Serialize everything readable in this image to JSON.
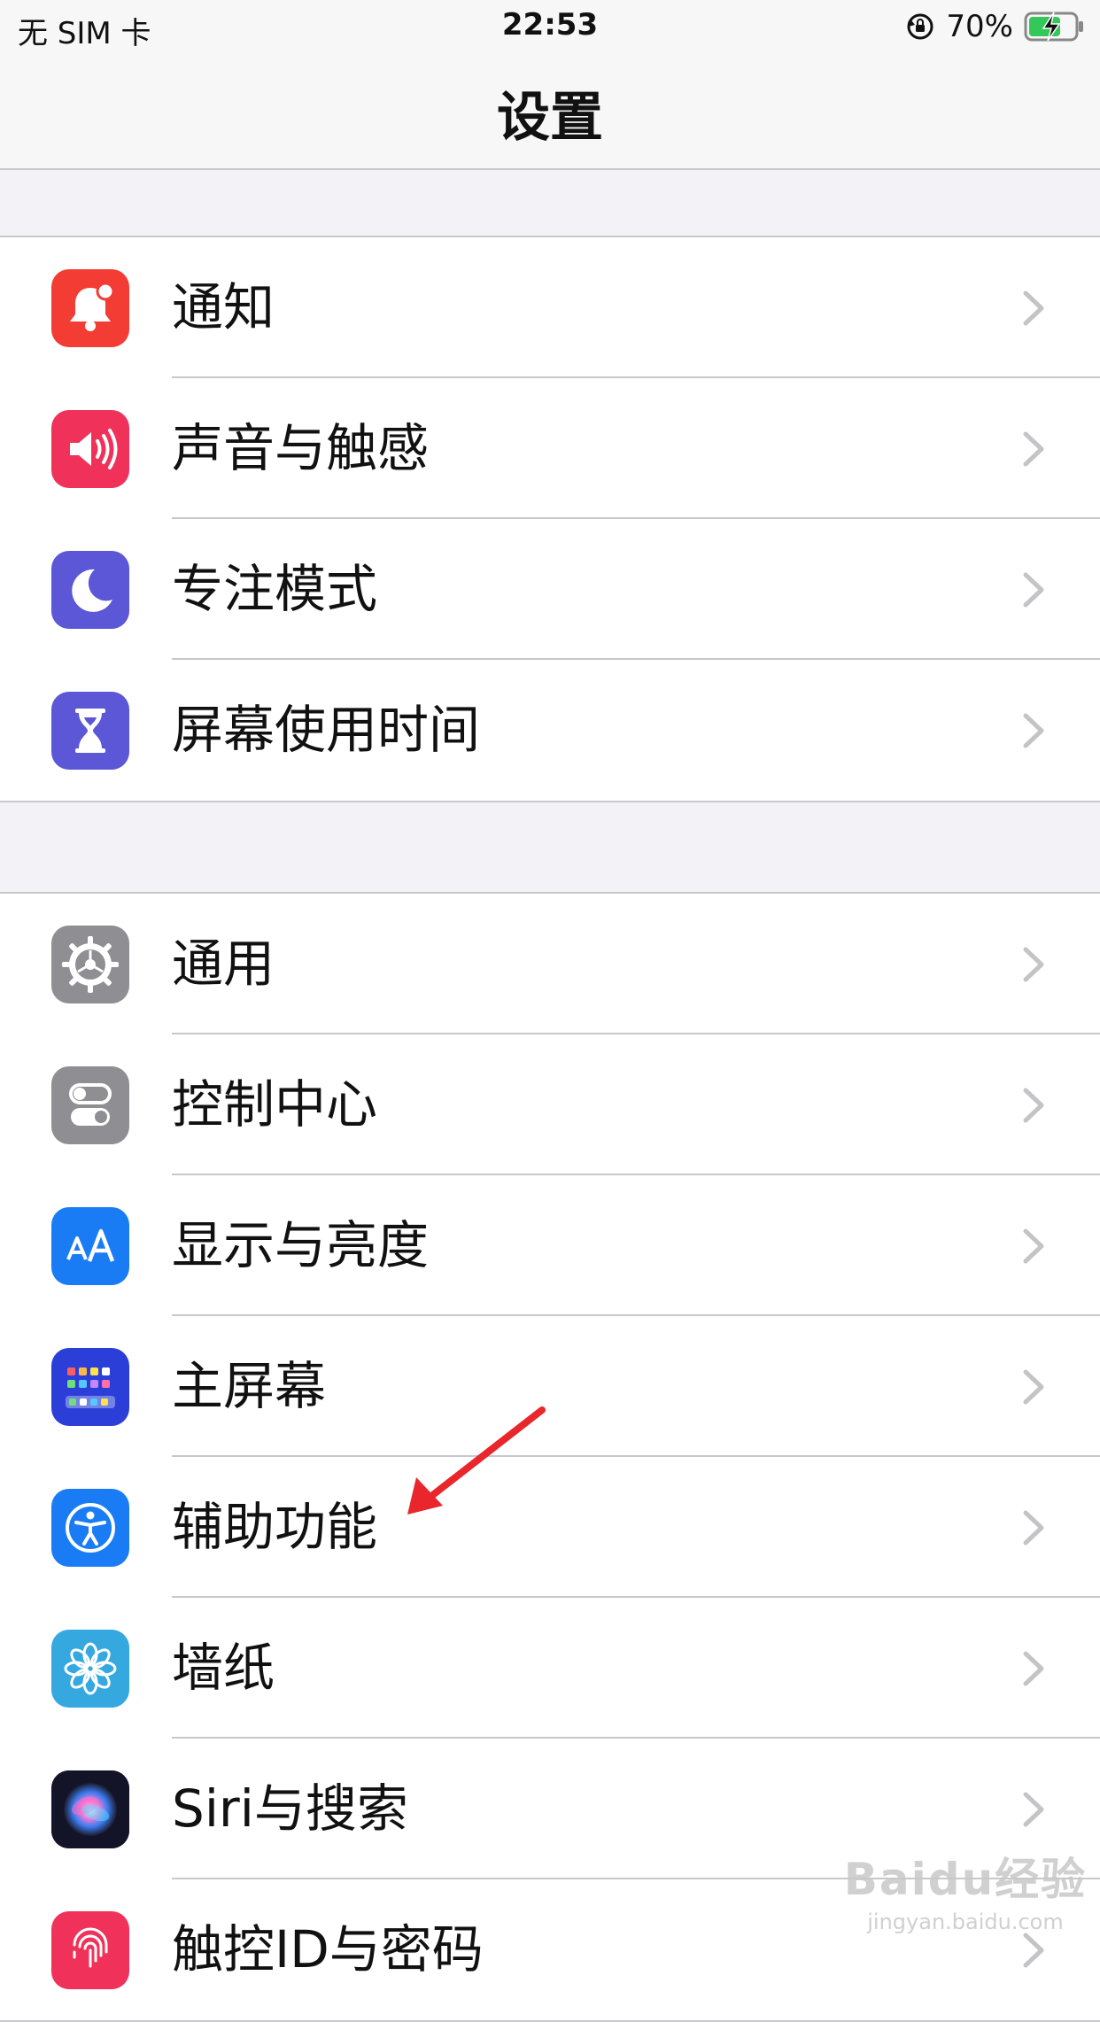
{
  "status_bar": {
    "carrier": "无 SIM 卡",
    "time": "22:53",
    "battery_percent": "70%",
    "battery_level": 0.7
  },
  "nav": {
    "title": "设置"
  },
  "groups": [
    {
      "items": [
        {
          "label": "通知",
          "icon": "notification-bell-icon",
          "color": "#f23c34"
        },
        {
          "label": "声音与触感",
          "icon": "speaker-icon",
          "color": "#f0325a"
        },
        {
          "label": "专注模式",
          "icon": "moon-icon",
          "color": "#5b57d6"
        },
        {
          "label": "屏幕使用时间",
          "icon": "hourglass-icon",
          "color": "#5b57d6"
        }
      ]
    },
    {
      "items": [
        {
          "label": "通用",
          "icon": "gear-icon",
          "color": "#8e8e93"
        },
        {
          "label": "控制中心",
          "icon": "toggle-switches-icon",
          "color": "#8e8e93"
        },
        {
          "label": "显示与亮度",
          "icon": "text-size-aa-icon",
          "color": "#1a7cf5"
        },
        {
          "label": "主屏幕",
          "icon": "home-screen-grid-icon",
          "color": "#2b3fd8"
        },
        {
          "label": "辅助功能",
          "icon": "accessibility-person-icon",
          "color": "#1a7cf5"
        },
        {
          "label": "墙纸",
          "icon": "flower-icon",
          "color": "#35a8e0"
        },
        {
          "label": "Siri与搜索",
          "icon": "siri-orb-icon",
          "color": "#1b1b2f"
        },
        {
          "label": "触控ID与密码",
          "icon": "fingerprint-icon",
          "color": "#f0325a"
        }
      ]
    }
  ],
  "watermark": {
    "brand": "Baidu经验",
    "url": "jingyan.baidu.com"
  },
  "colors": {
    "annotation_arrow": "#e8262b"
  }
}
